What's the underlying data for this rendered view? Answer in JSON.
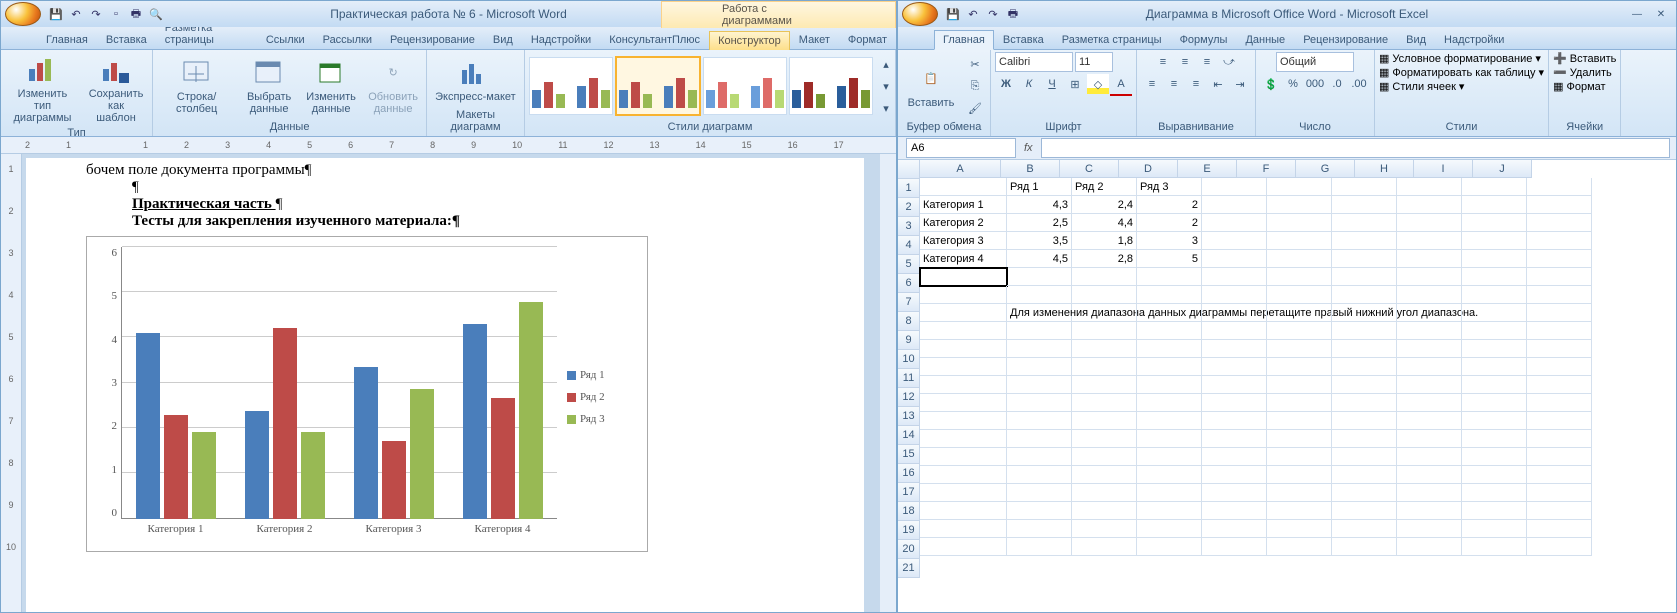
{
  "word": {
    "title": "Практическая работа  № 6 - Microsoft Word",
    "context_title": "Работа с диаграммами",
    "tabs": [
      "Главная",
      "Вставка",
      "Разметка страницы",
      "Ссылки",
      "Рассылки",
      "Рецензирование",
      "Вид",
      "Надстройки",
      "КонсультантПлюс"
    ],
    "ctx_tabs": [
      "Конструктор",
      "Макет",
      "Формат"
    ],
    "groups": {
      "type": {
        "label": "Тип",
        "btn1": "Изменить тип\nдиаграммы",
        "btn2": "Сохранить\nкак шаблон"
      },
      "data": {
        "label": "Данные",
        "btn1": "Строка/столбец",
        "btn2": "Выбрать\nданные",
        "btn3": "Изменить\nданные",
        "btn4": "Обновить\nданные"
      },
      "layouts": {
        "label": "Макеты диаграмм",
        "btn": "Экспресс-макет"
      },
      "styles": {
        "label": "Стили диаграмм"
      }
    },
    "doc": {
      "line1": "бочем поле документа программы¶",
      "pil": "¶",
      "heading": "Практическая часть ",
      "sub": "Тесты для закрепления изученного материала:¶"
    }
  },
  "excel": {
    "title": "Диаграмма в Microsoft Office Word - Microsoft Excel",
    "tabs": [
      "Главная",
      "Вставка",
      "Разметка страницы",
      "Формулы",
      "Данные",
      "Рецензирование",
      "Вид",
      "Надстройки"
    ],
    "groups": {
      "clipboard": {
        "label": "Буфер обмена",
        "paste": "Вставить"
      },
      "font": {
        "label": "Шрифт",
        "name": "Calibri",
        "size": "11"
      },
      "align": {
        "label": "Выравнивание"
      },
      "number": {
        "label": "Число",
        "fmt": "Общий"
      },
      "styles": {
        "label": "Стили",
        "cond": "Условное форматирование",
        "tbl": "Форматировать как таблицу",
        "cell": "Стили ячеек"
      },
      "cells": {
        "label": "Ячейки",
        "ins": "Вставить",
        "del": "Удалить",
        "fmt": "Формат"
      }
    },
    "namebox": "A6",
    "columns": [
      "A",
      "B",
      "C",
      "D",
      "E",
      "F",
      "G",
      "H",
      "I",
      "J"
    ],
    "rows": [
      1,
      2,
      3,
      4,
      5,
      6,
      7,
      8,
      9,
      10,
      11,
      12,
      13,
      14,
      15,
      16,
      17,
      18,
      19,
      20,
      21
    ],
    "headers": [
      "",
      "Ряд 1",
      "Ряд 2",
      "Ряд 3"
    ],
    "rowlabels": [
      "Категория 1",
      "Категория 2",
      "Категория 3",
      "Категория 4"
    ],
    "values": [
      [
        "4,3",
        "2,4",
        "2"
      ],
      [
        "2,5",
        "4,4",
        "2"
      ],
      [
        "3,5",
        "1,8",
        "3"
      ],
      [
        "4,5",
        "2,8",
        "5"
      ]
    ],
    "note": "Для изменения диапазона данных диаграммы перетащите правый нижний угол диапазона."
  },
  "chart_data": {
    "type": "bar",
    "categories": [
      "Категория 1",
      "Категория 2",
      "Категория 3",
      "Категория 4"
    ],
    "series": [
      {
        "name": "Ряд 1",
        "values": [
          4.3,
          2.5,
          3.5,
          4.5
        ],
        "color": "#4a7ebb"
      },
      {
        "name": "Ряд 2",
        "values": [
          2.4,
          4.4,
          1.8,
          2.8
        ],
        "color": "#be4b48"
      },
      {
        "name": "Ряд 3",
        "values": [
          2,
          2,
          3,
          5
        ],
        "color": "#98b954"
      }
    ],
    "ylim": [
      0,
      6
    ],
    "yticks": [
      0,
      1,
      2,
      3,
      4,
      5,
      6
    ]
  }
}
